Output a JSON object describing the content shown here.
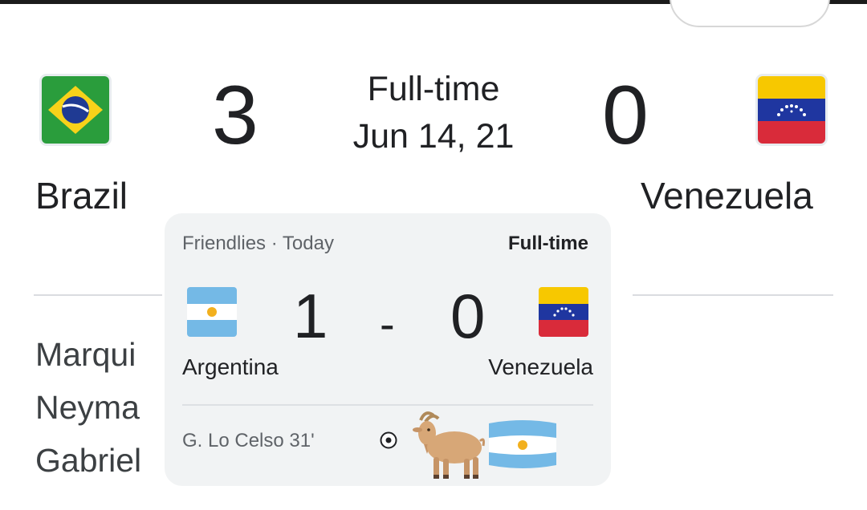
{
  "previous_match": {
    "home": {
      "name": "Brazil",
      "score": "3",
      "flag_icon": "brazil-flag-icon"
    },
    "away": {
      "name": "Venezuela",
      "score": "0",
      "flag_icon": "venezuela-flag-icon"
    },
    "status": "Full-time",
    "date": "Jun 14, 21",
    "scorers_partial": [
      "Marqui",
      "Neyma",
      "Gabriel"
    ]
  },
  "card": {
    "competition": "Friendlies · Today",
    "status": "Full-time",
    "home": {
      "name": "Argentina",
      "score": "1",
      "flag_icon": "argentina-flag-icon"
    },
    "separator": "-",
    "away": {
      "name": "Venezuela",
      "score": "0",
      "flag_icon": "venezuela-flag-icon"
    },
    "scorer": "G. Lo Celso 31'",
    "stickers": [
      "goat-emoji",
      "argentina-flag-emoji"
    ]
  },
  "colors": {
    "card_bg": "#f1f3f4",
    "brazil_green": "#2a9d3c",
    "brazil_yellow": "#f7d21a",
    "brazil_blue": "#1f3a93",
    "venezuela_yellow": "#f7c800",
    "venezuela_blue": "#1f36a0",
    "venezuela_red": "#d92b3a",
    "argentina_blue": "#74b9e6"
  }
}
